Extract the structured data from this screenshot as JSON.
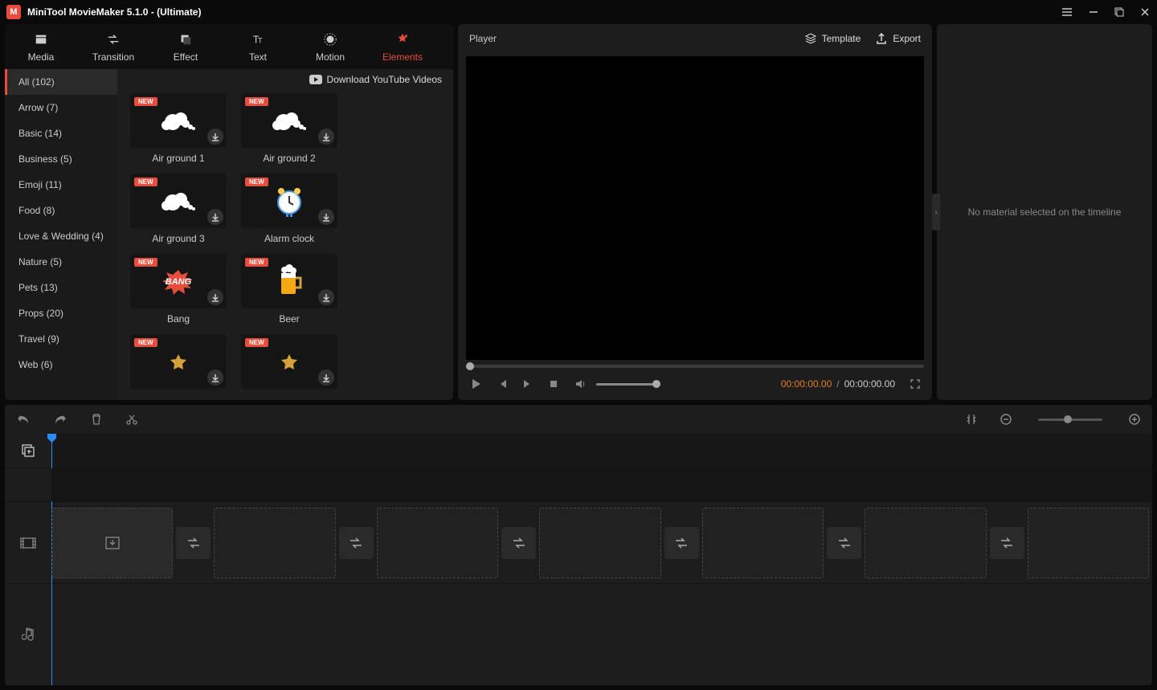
{
  "titlebar": {
    "title": "MiniTool MovieMaker 5.1.0 - (Ultimate)"
  },
  "tabs": {
    "media": "Media",
    "transition": "Transition",
    "effect": "Effect",
    "text": "Text",
    "motion": "Motion",
    "elements": "Elements"
  },
  "download_banner": "Download YouTube Videos",
  "categories": [
    "All (102)",
    "Arrow (7)",
    "Basic (14)",
    "Business (5)",
    "Emoji (11)",
    "Food (8)",
    "Love & Wedding (4)",
    "Nature (5)",
    "Pets (13)",
    "Props (20)",
    "Travel (9)",
    "Web (6)"
  ],
  "new_badge": "NEW",
  "elements": [
    {
      "name": "Air ground 1",
      "type": "smoke"
    },
    {
      "name": "Air ground 2",
      "type": "smoke"
    },
    {
      "name": "Air ground 3",
      "type": "smoke"
    },
    {
      "name": "Alarm clock",
      "type": "clock"
    },
    {
      "name": "Bang",
      "type": "bang"
    },
    {
      "name": "Beer",
      "type": "beer"
    },
    {
      "name": "",
      "type": "placeholder"
    },
    {
      "name": "",
      "type": "placeholder"
    }
  ],
  "player": {
    "title": "Player",
    "template": "Template",
    "export": "Export",
    "time_current": "00:00:00.00",
    "time_total": "00:00:00.00",
    "time_sep": "/"
  },
  "properties": {
    "empty": "No material selected on the timeline"
  }
}
